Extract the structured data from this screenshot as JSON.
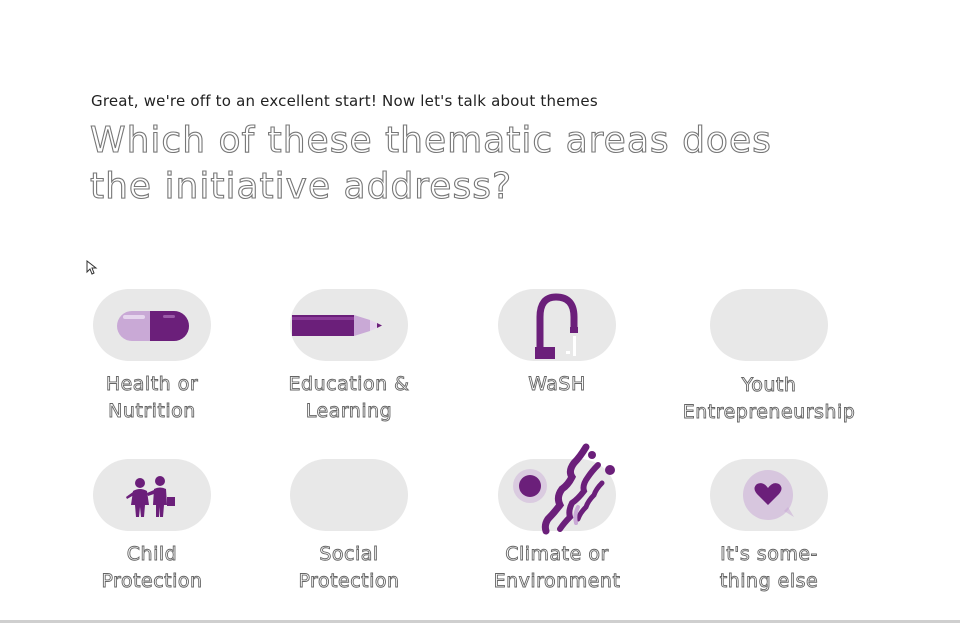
{
  "header": {
    "intro": "Great, we're off to an excellent start! Now let's talk about themes",
    "question_line1": "Which of these thematic areas does",
    "question_line2": "the initiative address?"
  },
  "options": [
    {
      "line1": "Health or",
      "line2": "Nutrition",
      "icon": "pill-capsule-icon"
    },
    {
      "line1": "Education &",
      "line2": "Learning",
      "icon": "pencil-icon"
    },
    {
      "line1": "WaSH",
      "line2": "",
      "icon": "water-tap-icon"
    },
    {
      "line1": "Youth",
      "line2": "Entrepreneurship",
      "icon": ""
    },
    {
      "line1": "Child",
      "line2": "Protection",
      "icon": "children-icon"
    },
    {
      "line1": "Social",
      "line2": "Protection",
      "icon": ""
    },
    {
      "line1": "Climate or",
      "line2": "Environment",
      "icon": "sun-waves-icon"
    },
    {
      "line1": "It's some-",
      "line2": "thing else",
      "icon": "heart-bubble-icon"
    }
  ],
  "colors": {
    "accent": "#6b1f7a",
    "accent_light": "#c9a9d6",
    "pill_bg": "#e8e8e8"
  }
}
